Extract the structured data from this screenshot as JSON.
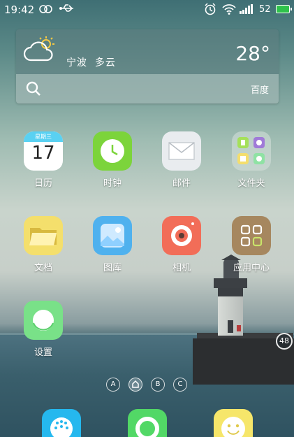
{
  "status_bar": {
    "time": "19:42",
    "battery": "52"
  },
  "weather": {
    "city": "宁波",
    "condition": "多云",
    "temperature": "28°"
  },
  "search": {
    "engine": "百度"
  },
  "apps": {
    "calendar": {
      "label": "日历",
      "weekday": "星期三",
      "day": "17"
    },
    "clock": {
      "label": "时钟"
    },
    "mail": {
      "label": "邮件"
    },
    "folder": {
      "label": "文件夹"
    },
    "docs": {
      "label": "文档"
    },
    "gallery": {
      "label": "图库"
    },
    "camera": {
      "label": "相机"
    },
    "app_center": {
      "label": "应用中心"
    },
    "settings": {
      "label": "设置"
    }
  },
  "pager": {
    "dots": [
      "A",
      "B",
      "C"
    ]
  },
  "side_badge": "48",
  "colors": {
    "battery": "#2ec24b",
    "calendar_header": "#5ad1f2",
    "clock": "#7cd43b",
    "camera": "#f26d58",
    "settings": "#79e188"
  }
}
